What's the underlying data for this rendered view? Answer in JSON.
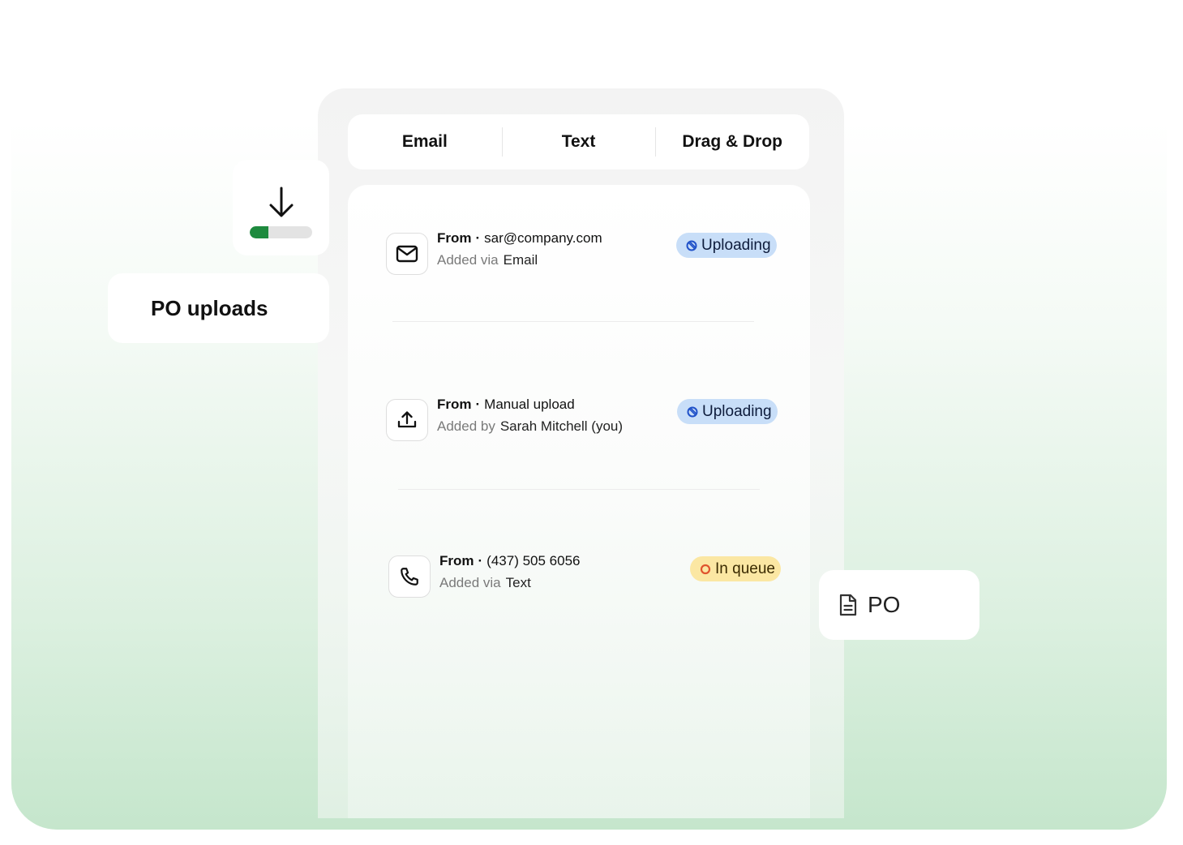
{
  "tabs": [
    "Email",
    "Text",
    "Drag & Drop"
  ],
  "side": {
    "title": "PO uploads",
    "download_progress": 0.3
  },
  "file_chip": {
    "label": "PO"
  },
  "uploads": [
    {
      "from_label": "From",
      "source": "sar@company.com",
      "added_label": "Added via",
      "added_value": "Email",
      "status": "Uploading",
      "icon": "mail-icon"
    },
    {
      "from_label": "From",
      "source": "Manual upload",
      "added_label": "Added by",
      "added_value": "Sarah Mitchell (you)",
      "status": "Uploading",
      "icon": "upload-icon"
    },
    {
      "from_label": "From",
      "source": "(437) 505 6056",
      "added_label": "Added via",
      "added_value": "Text",
      "status": "In queue",
      "icon": "phone-icon"
    }
  ],
  "colors": {
    "progress_fill": "#1e8a3e",
    "uploading_badge": "#c8def8",
    "queue_badge": "#fbe7a3",
    "queue_ring": "#e0542e",
    "uploading_icon": "#2152c9"
  }
}
